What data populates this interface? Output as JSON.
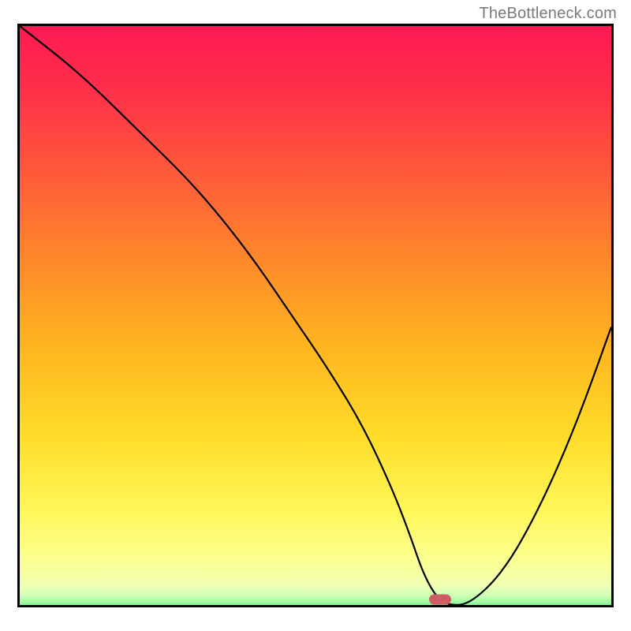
{
  "watermark": "TheBottleneck.com",
  "colors": {
    "gradient_stops": [
      {
        "offset": 0.0,
        "color": "#ff1a53"
      },
      {
        "offset": 0.1,
        "color": "#ff2d4a"
      },
      {
        "offset": 0.25,
        "color": "#ff5a3a"
      },
      {
        "offset": 0.4,
        "color": "#ff8a2a"
      },
      {
        "offset": 0.55,
        "color": "#ffb71f"
      },
      {
        "offset": 0.7,
        "color": "#ffde2a"
      },
      {
        "offset": 0.82,
        "color": "#fff75a"
      },
      {
        "offset": 0.9,
        "color": "#fcff8e"
      },
      {
        "offset": 0.945,
        "color": "#f1ffb4"
      },
      {
        "offset": 0.965,
        "color": "#c8ffb4"
      },
      {
        "offset": 0.985,
        "color": "#67f587"
      },
      {
        "offset": 1.0,
        "color": "#1de27a"
      }
    ],
    "curve": "#000000",
    "border": "#000000",
    "marker": "#cf5b63"
  },
  "chart_data": {
    "type": "line",
    "title": "",
    "xlabel": "",
    "ylabel": "",
    "xlim": [
      0,
      100
    ],
    "ylim": [
      0,
      100
    ],
    "grid": false,
    "legend": false,
    "series": [
      {
        "name": "bottleneck-curve",
        "x": [
          0,
          10,
          20,
          28,
          34,
          40,
          46,
          52,
          58,
          63,
          66,
          68,
          70,
          72,
          76,
          82,
          88,
          94,
          100
        ],
        "y": [
          100,
          92,
          82,
          74,
          67,
          59,
          50,
          41,
          31,
          20,
          12,
          6,
          2,
          0,
          0,
          6,
          17,
          31,
          48
        ]
      }
    ],
    "marker": {
      "x": 71,
      "y": 1,
      "shape": "pill",
      "color": "#cf5b63"
    }
  }
}
